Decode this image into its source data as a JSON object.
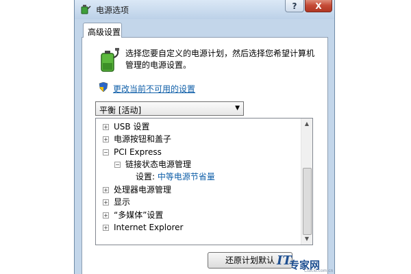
{
  "window": {
    "title": "电源选项",
    "help_label": "?",
    "close_label": "X",
    "app_icon": "power-options-icon"
  },
  "tabs": [
    {
      "label": "高级设置",
      "active": true
    }
  ],
  "description": {
    "icon": "battery-plug-icon",
    "text": "选择您要自定义的电源计划，然后选择您希望计算机管理的电源设置。"
  },
  "link": {
    "icon": "uac-shield-icon",
    "text": "更改当前不可用的设置"
  },
  "plan_select": {
    "value": "平衡 [活动]"
  },
  "tree": {
    "items": [
      {
        "toggle": "+",
        "label": "USB 设置"
      },
      {
        "toggle": "+",
        "label": "电源按钮和盖子"
      },
      {
        "toggle": "−",
        "label": "PCI Express"
      },
      {
        "toggle": "−",
        "label": "链接状态电源管理"
      },
      {
        "setting_label": "设置:",
        "setting_value": "中等电源节省量"
      },
      {
        "toggle": "+",
        "label": "处理器电源管理"
      },
      {
        "toggle": "+",
        "label": "显示"
      },
      {
        "toggle": "+",
        "label": "“多媒体”设置"
      },
      {
        "toggle": "+",
        "label": "Internet Explorer"
      }
    ]
  },
  "buttons": {
    "restore_label": "还原计划默认"
  },
  "watermark": {
    "logo": "IT",
    "name": "专家网",
    "url": "Ctocio.com.cn"
  },
  "colors": {
    "link": "#0e5ea8",
    "title_bar": "#c3d6ea",
    "close_button": "#c44a36"
  }
}
